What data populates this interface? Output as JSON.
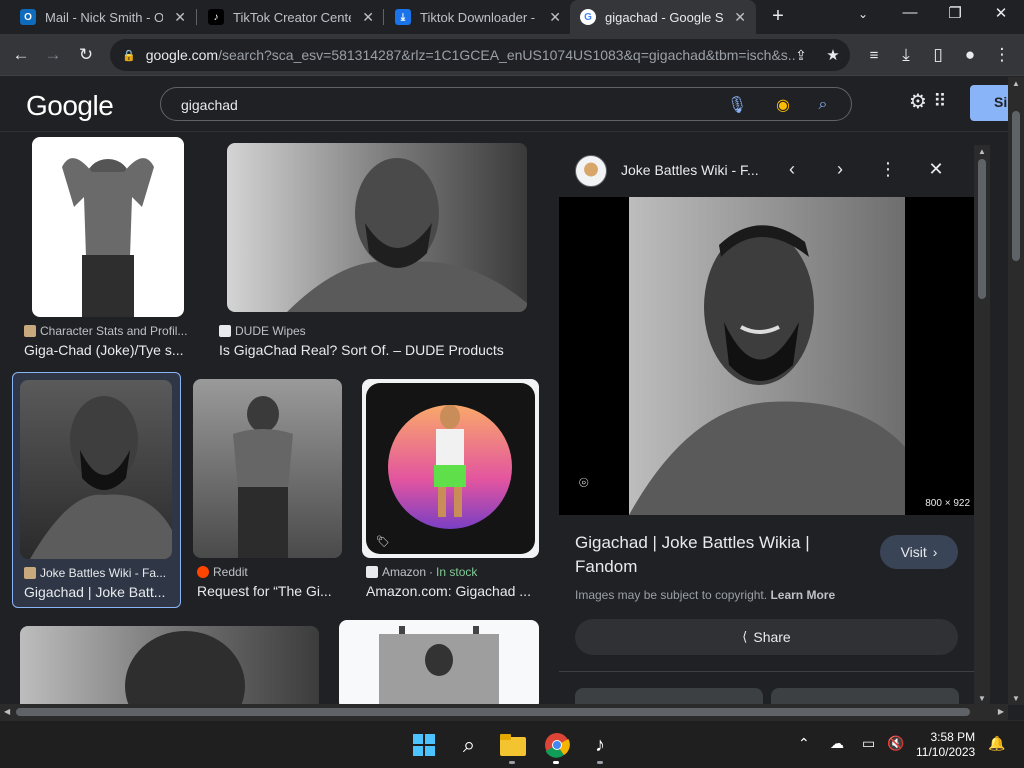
{
  "tabs": [
    {
      "title": "Mail - Nick Smith - Ou",
      "favicon": "outlook-icon",
      "color": "#0f6cbd"
    },
    {
      "title": "TikTok Creator Center",
      "favicon": "tiktok-icon",
      "color": "#000000"
    },
    {
      "title": "Tiktok Downloader - D",
      "favicon": "download-icon",
      "color": "#1a73e8"
    },
    {
      "title": "gigachad - Google Se",
      "favicon": "google-icon",
      "color": "#ffffff"
    }
  ],
  "address": {
    "host": "google.com",
    "path": "/search?sca_esv=581314287&rlz=1C1GCEA_enUS1074US1083&q=gigachad&tbm=isch&s..."
  },
  "google": {
    "logo": "Google",
    "query": "gigachad",
    "signin_label": "Si"
  },
  "results": [
    {
      "source": "Character Stats and Profil...",
      "caption": "Giga-Chad (Joke)/Tye s..."
    },
    {
      "source": "DUDE Wipes",
      "caption": "Is GigaChad Real? Sort Of. – DUDE Products"
    },
    {
      "source": "Joke Battles Wiki - Fa...",
      "caption": "Gigachad | Joke Batt..."
    },
    {
      "source": "Reddit",
      "caption": "Request for “The Gi..."
    },
    {
      "source": "Amazon",
      "stock": "In stock",
      "caption": "Amazon.com: Gigachad ..."
    }
  ],
  "preview": {
    "site": "Joke Battles Wiki - F...",
    "dimensions": "800 × 922",
    "title": "Gigachad | Joke Battles Wikia | Fandom",
    "visit_label": "Visit",
    "copyright": "Images may be subject to copyright.",
    "learn_more": "Learn More",
    "share_label": "Share"
  },
  "taskbar": {
    "time": "3:58 PM",
    "date": "11/10/2023"
  },
  "colors": {
    "background": "#202124",
    "accent": "#8ab4f8",
    "stock_green": "#81c995"
  }
}
